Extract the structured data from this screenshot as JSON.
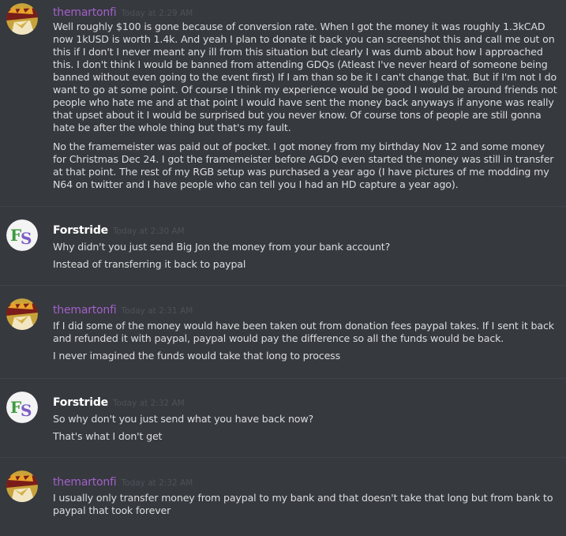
{
  "colors": {
    "background": "#36393e",
    "username_purple": "#a260c9",
    "username_white": "#ffffff",
    "timestamp": "#4e5259",
    "message_text": "#dcddde",
    "divider": "#404349"
  },
  "groups": [
    {
      "avatar": "themartonfi-avatar-icon",
      "username": "themartonfi",
      "timestamp": "Today at 2:29 AM",
      "messages": [
        "Well roughly $100 is gone because of conversion rate. When I got the money it was roughly 1.3kCAD now 1kUSD is worth 1.4k. And yeah I plan to donate it back you can screenshot this and call me out on this if I don't I never meant any ill from this situation but clearly I was dumb about how I approached this. I don't think I would be banned from attending GDQs (Atleast I've never heard of someone being banned without even going to the event first) If I am than so be it I can't change that. But if I'm not I do want to go at some point. Of course I think my experience would be good I would be around friends not people who hate me and at that point I would have sent the money back anyways if anyone was really that upset about it I would be surprised but you never know. Of course tons of people are still gonna hate be after the whole thing but that's my fault.",
        "No the framemeister was paid out of pocket. I got money from my birthday Nov 12 and some money for Christmas Dec 24. I got the framemeister before AGDQ even started the money was still in transfer at that point. The rest of my RGB setup was purchased a year ago (I have pictures of me modding my N64 on twitter and I have people who can tell you I had an HD capture a year ago)."
      ]
    },
    {
      "avatar": "forstride-avatar-icon",
      "username": "Forstride",
      "timestamp": "Today at 2:30 AM",
      "messages": [
        "Why didn't you just send Big Jon the money from your bank account?",
        "Instead of transferring it back to paypal"
      ]
    },
    {
      "avatar": "themartonfi-avatar-icon",
      "username": "themartonfi",
      "timestamp": "Today at 2:31 AM",
      "messages": [
        "If I did some of the money would have been taken out from donation fees paypal takes. If I sent it back and refunded it with paypal, paypal would pay the difference so all the funds would be back.",
        "I never imagined the funds would take that long to process"
      ]
    },
    {
      "avatar": "forstride-avatar-icon",
      "username": "Forstride",
      "timestamp": "Today at 2:32 AM",
      "messages": [
        "So why don't you just send what you have back now?",
        "That's what I don't get"
      ]
    },
    {
      "avatar": "themartonfi-avatar-icon",
      "username": "themartonfi",
      "timestamp": "Today at 2:32 AM",
      "messages": [
        "I usually only transfer money from paypal to my bank and that doesn't take that long but from bank to paypal that took forever"
      ]
    }
  ]
}
